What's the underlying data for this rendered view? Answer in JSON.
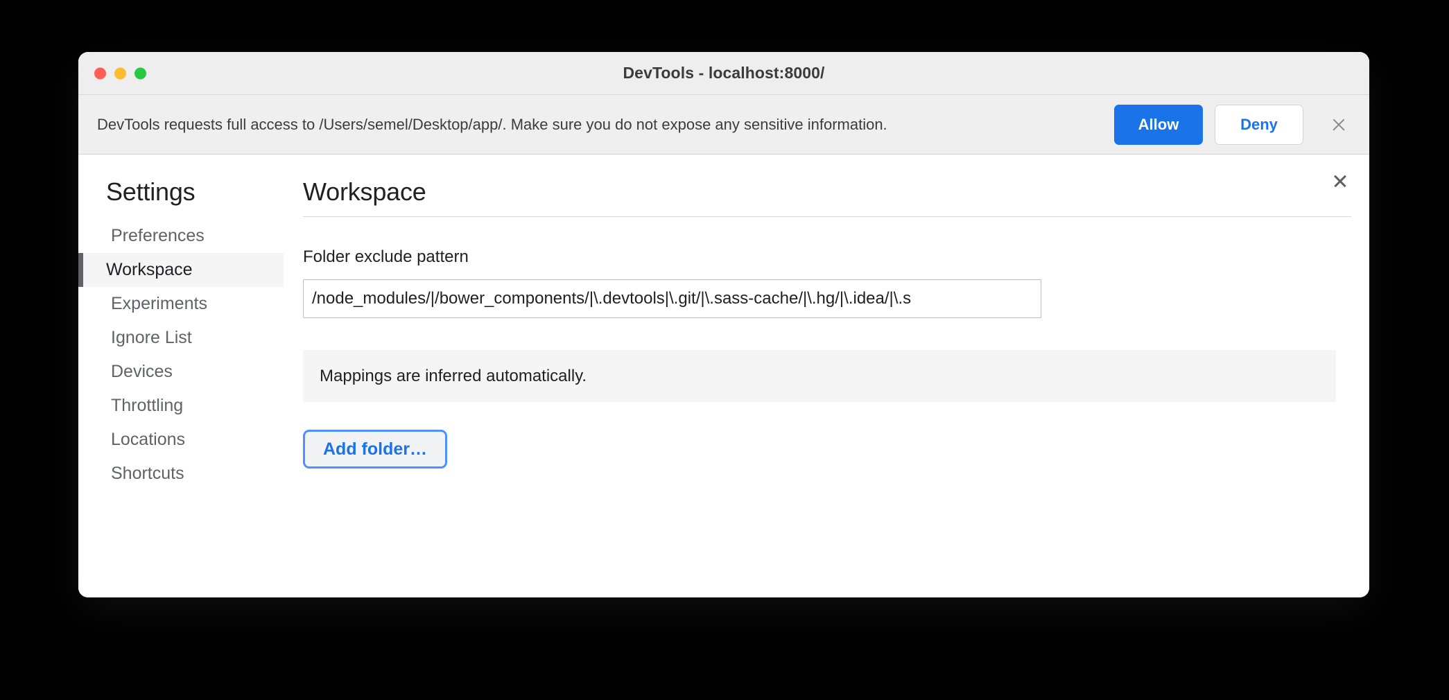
{
  "window": {
    "title": "DevTools - localhost:8000/",
    "traffic_lights": [
      "close",
      "minimize",
      "zoom"
    ]
  },
  "banner": {
    "message": "DevTools requests full access to /Users/semel/Desktop/app/. Make sure you do not expose any sensitive information.",
    "allow_label": "Allow",
    "deny_label": "Deny",
    "close_icon": "close-icon",
    "allow_color": "#1a73e8",
    "deny_color": "#1a73e8"
  },
  "settings": {
    "close_icon": "close-icon",
    "sidebar": {
      "title": "Settings",
      "items": [
        {
          "label": "Preferences",
          "selected": false
        },
        {
          "label": "Workspace",
          "selected": true
        },
        {
          "label": "Experiments",
          "selected": false
        },
        {
          "label": "Ignore List",
          "selected": false
        },
        {
          "label": "Devices",
          "selected": false
        },
        {
          "label": "Throttling",
          "selected": false
        },
        {
          "label": "Locations",
          "selected": false
        },
        {
          "label": "Shortcuts",
          "selected": false
        }
      ]
    },
    "panel": {
      "title": "Workspace",
      "field_label": "Folder exclude pattern",
      "exclude_pattern_value": "/node_modules/|/bower_components/|\\.devtools|\\.git/|\\.sass-cache/|\\.hg/|\\.idea/|\\.s",
      "exclude_pattern_placeholder": "",
      "mappings_message": "Mappings are inferred automatically.",
      "add_folder_label": "Add folder…"
    }
  }
}
